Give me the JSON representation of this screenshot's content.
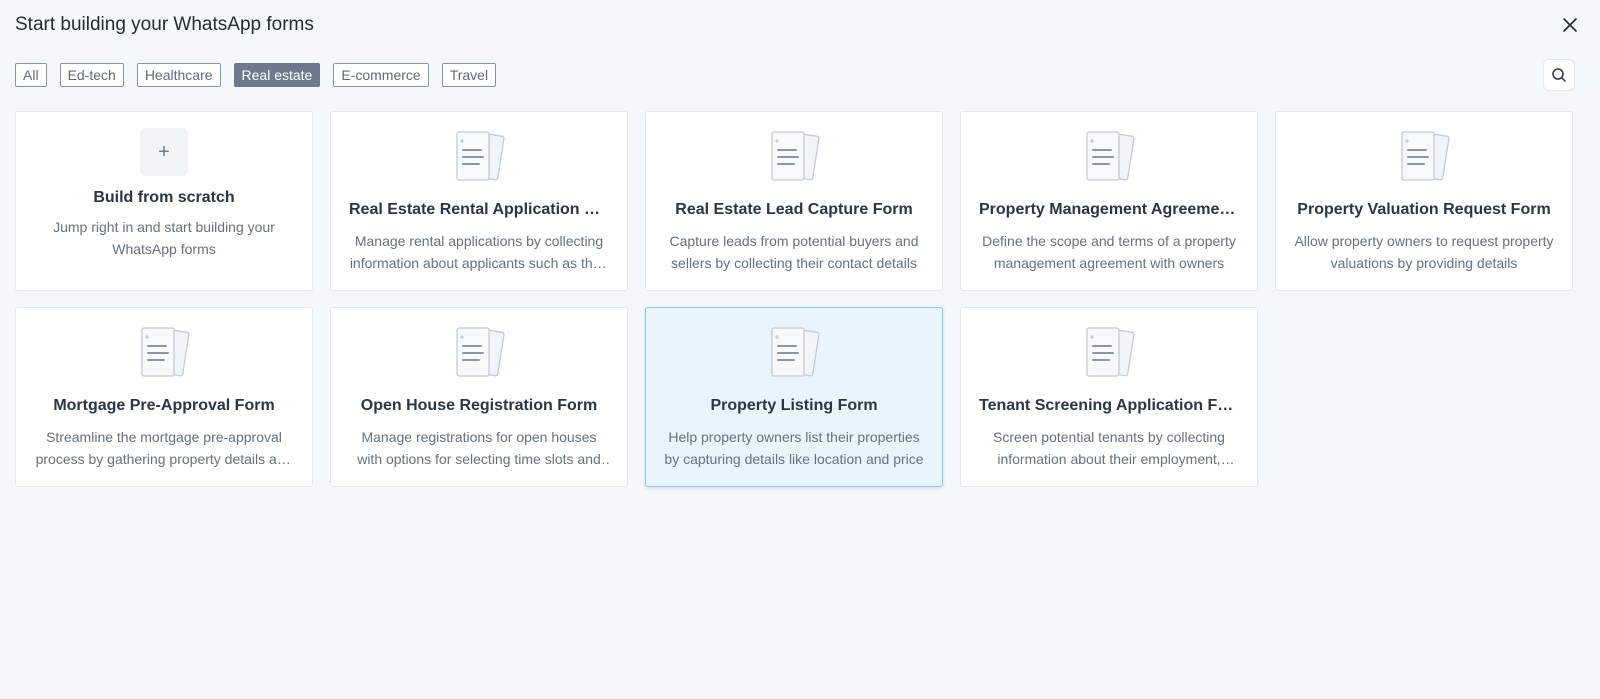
{
  "header": {
    "title": "Start building your WhatsApp forms"
  },
  "filters": [
    {
      "label": "All",
      "active": false
    },
    {
      "label": "Ed-tech",
      "active": false
    },
    {
      "label": "Healthcare",
      "active": false
    },
    {
      "label": "Real estate",
      "active": true
    },
    {
      "label": "E-commerce",
      "active": false
    },
    {
      "label": "Travel",
      "active": false
    }
  ],
  "scratch": {
    "icon": "+",
    "title": "Build from scratch",
    "description": "Jump right in and start building your WhatsApp forms"
  },
  "cards": [
    {
      "title": "Real Estate Rental Application Form",
      "description": "Manage rental applications by collecting information about applicants such as their personal details"
    },
    {
      "title": "Real Estate Lead Capture Form",
      "description": "Capture leads from potential buyers and sellers by collecting their contact details"
    },
    {
      "title": "Property Management Agreement Form",
      "description": "Define the scope and terms of a property management agreement with owners"
    },
    {
      "title": "Property Valuation Request Form",
      "description": "Allow property owners to request property valuations by providing details"
    },
    {
      "title": "Mortgage Pre-Approval Form",
      "description": "Streamline the mortgage pre-approval process by gathering property details and income"
    },
    {
      "title": "Open House Registration Form",
      "description": "Manage registrations for open houses with options for selecting time slots and more"
    },
    {
      "title": "Property Listing Form",
      "description": "Help property owners list their properties by capturing details like location and price",
      "selected": true
    },
    {
      "title": "Tenant Screening Application Form",
      "description": "Screen potential tenants by collecting information about their employment, income and references"
    }
  ],
  "icons": {
    "close": "close-icon",
    "search": "search-icon",
    "document": "document-icon"
  },
  "colors": {
    "active_chip": "#6d7a8d",
    "selected_card_bg": "#e9f5fc",
    "selected_card_border": "#8fcbe8"
  }
}
